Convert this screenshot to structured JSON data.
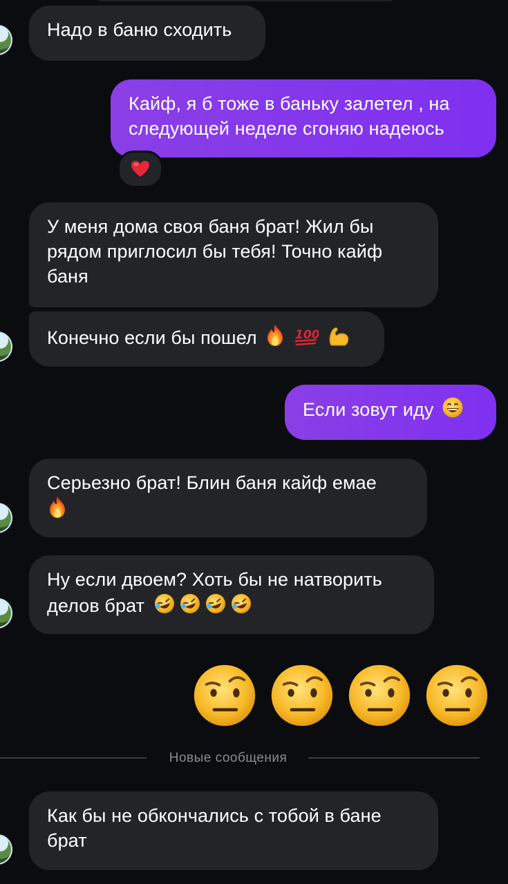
{
  "messages": {
    "m1": "Надо в баню сходить",
    "m2_line1": "Кайф, я б тоже в баньку залетел , на",
    "m2_line2": "следующей неделе сгоняю надеюсь",
    "m2_reaction": "heart",
    "m3_line1": "У меня дома своя баня брат! Жил бы",
    "m3_line2": "рядом приглосил бы тебя! Точно кайф",
    "m3_line3": "баня",
    "m4": "Конечно если бы пошел",
    "m4_emojis": [
      "fire",
      "hundred-points",
      "flexed-biceps"
    ],
    "m5": "Если зовут иду",
    "m5_emoji": "grinning-face",
    "m6_line1": "Серьезно брат! Блин баня кайф емае",
    "m6_emoji": "fire",
    "m7_line1": "Ну если двоем? Хоть бы не натворить",
    "m7_line2": "делов брат",
    "m7_emojis": [
      "rolling-laughing",
      "rolling-laughing",
      "rolling-laughing",
      "rolling-laughing"
    ],
    "m8_emojis": [
      "raised-eyebrow",
      "raised-eyebrow",
      "raised-eyebrow",
      "raised-eyebrow"
    ],
    "m9_line1": "Как бы не обкончались с тобой в бане",
    "m9_line2": "брат"
  },
  "divider": {
    "label": "Новые сообщения"
  },
  "colors": {
    "background": "#0b0c10",
    "incoming_bubble": "#232428",
    "outgoing_bubble": "#8a3fe6"
  }
}
